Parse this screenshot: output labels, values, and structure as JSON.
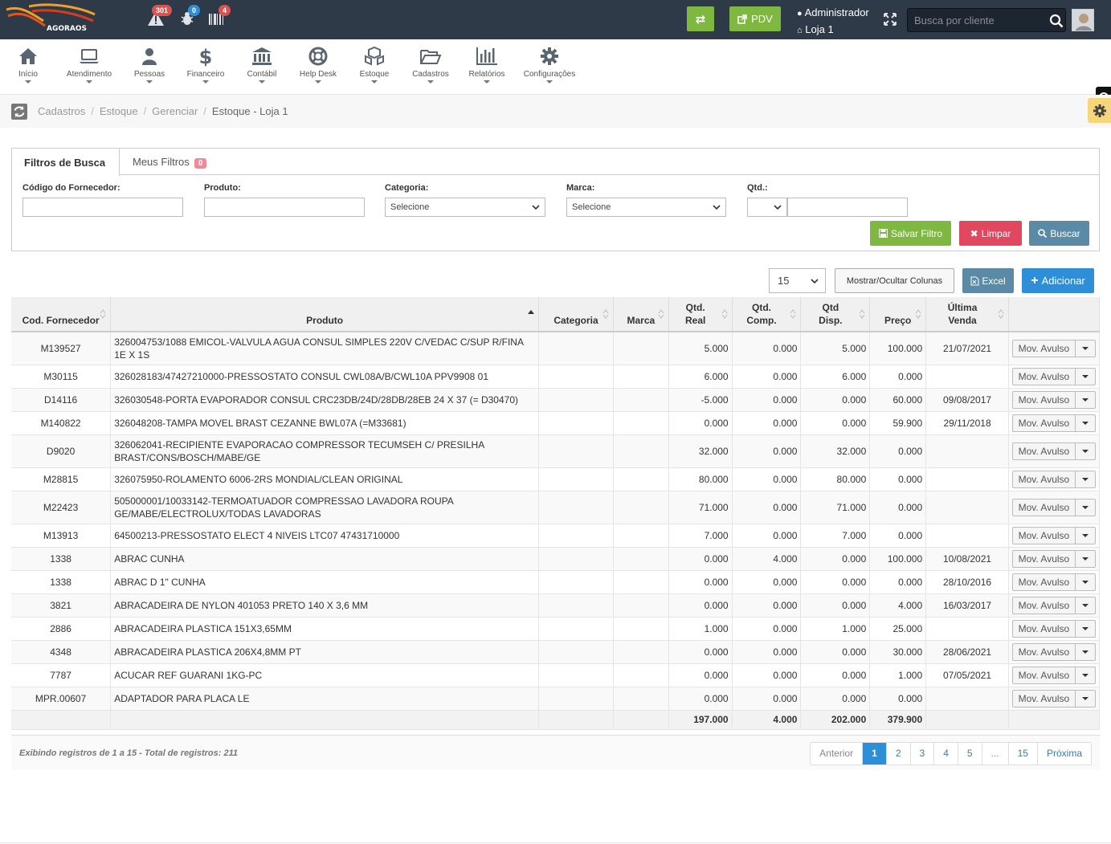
{
  "brand": {
    "logo_text": "AGORAOS"
  },
  "topbar": {
    "alerts": [
      {
        "icon": "warning-icon",
        "count": "301",
        "color": "#d9534f"
      },
      {
        "icon": "bug-icon",
        "count": "0",
        "color": "#2e8ed8"
      },
      {
        "icon": "barcode-icon",
        "count": "4",
        "color": "#d9534f"
      }
    ],
    "swap_label": "⇄",
    "pdv_label": "PDV",
    "user": "Administrador",
    "store": "Loja 1",
    "search_placeholder": "Busca por cliente"
  },
  "menu": [
    {
      "label": "Início",
      "icon": "home-icon"
    },
    {
      "label": "Atendimento",
      "icon": "laptop-icon"
    },
    {
      "label": "Pessoas",
      "icon": "user-icon"
    },
    {
      "label": "Financeiro",
      "icon": "dollar-icon"
    },
    {
      "label": "Contábil",
      "icon": "bank-icon"
    },
    {
      "label": "Help Desk",
      "icon": "lifebuoy-icon"
    },
    {
      "label": "Estoque",
      "icon": "cubes-icon"
    },
    {
      "label": "Cadastros",
      "icon": "folder-icon"
    },
    {
      "label": "Relatórios",
      "icon": "bar-chart-icon"
    },
    {
      "label": "Configurações",
      "icon": "gear-icon"
    }
  ],
  "breadcrumb": [
    "Cadastros",
    "Estoque",
    "Gerenciar",
    "Estoque - Loja 1"
  ],
  "filters": {
    "tab_active": "Filtros de Busca",
    "tab_other": "Meus Filtros",
    "tab_other_count": "0",
    "labels": {
      "supplier_code": "Código do Fornecedor:",
      "product": "Produto:",
      "category": "Categoria:",
      "brand": "Marca:",
      "qty": "Qtd.:"
    },
    "category_value": "Selecione",
    "brand_value": "Selecione",
    "save_label": "Salvar Filtro",
    "clear_label": "Limpar",
    "search_label": "Buscar"
  },
  "toolbar": {
    "page_size": "15",
    "columns_label": "Mostrar/Ocultar Colunas",
    "excel_label": "Excel",
    "add_label": "Adicionar"
  },
  "table": {
    "headers": [
      "Cod. Fornecedor",
      "Produto",
      "Categoria",
      "Marca",
      "Qtd. Real",
      "Qtd. Comp.",
      "Qtd Disp.",
      "Preço",
      "Última Venda"
    ],
    "action_label": "Mov. Avulso",
    "rows": [
      {
        "code": "M139527",
        "product": "326004753/1088 EMICOL-VALVULA AGUA CONSUL SIMPLES 220V C/VEDAC C/SUP R/FINA 1E X 1S",
        "category": "",
        "brand": "",
        "real": "5.000",
        "comp": "0.000",
        "disp": "5.000",
        "price": "100.000",
        "last": "21/07/2021"
      },
      {
        "code": "M30115",
        "product": "326028183/47427210000-PRESSOSTATO CONSUL CWL08A/B/CWL10A PPV9908 01",
        "category": "",
        "brand": "",
        "real": "6.000",
        "comp": "0.000",
        "disp": "6.000",
        "price": "0.000",
        "last": ""
      },
      {
        "code": "D14116",
        "product": "326030548-PORTA EVAPORADOR CONSUL CRC23DB/24D/28DB/28EB 24 X 37 (= D30470)",
        "category": "",
        "brand": "",
        "real": "-5.000",
        "comp": "0.000",
        "disp": "0.000",
        "price": "60.000",
        "last": "09/08/2017"
      },
      {
        "code": "M140822",
        "product": "326048208-TAMPA MOVEL BRAST CEZANNE BWL07A (=M33681)",
        "category": "",
        "brand": "",
        "real": "0.000",
        "comp": "0.000",
        "disp": "0.000",
        "price": "59.900",
        "last": "29/11/2018"
      },
      {
        "code": "D9020",
        "product": "326062041-RECIPIENTE EVAPORACAO COMPRESSOR TECUMSEH C/ PRESILHA BRAST/CONS/BOSCH/MABE/GE",
        "category": "",
        "brand": "",
        "real": "32.000",
        "comp": "0.000",
        "disp": "32.000",
        "price": "0.000",
        "last": ""
      },
      {
        "code": "M28815",
        "product": "326075950-ROLAMENTO 6006-2RS MONDIAL/CLEAN ORIGINAL",
        "category": "",
        "brand": "",
        "real": "80.000",
        "comp": "0.000",
        "disp": "80.000",
        "price": "0.000",
        "last": ""
      },
      {
        "code": "M22423",
        "product": "505000001/10033142-TERMOATUADOR COMPRESSAO LAVADORA ROUPA GE/MABE/ELECTROLUX/TODAS LAVADORAS",
        "category": "",
        "brand": "",
        "real": "71.000",
        "comp": "0.000",
        "disp": "71.000",
        "price": "0.000",
        "last": ""
      },
      {
        "code": "M13913",
        "product": "64500213-PRESSOSTATO ELECT 4 NIVEIS LTC07 47431710000",
        "category": "",
        "brand": "",
        "real": "7.000",
        "comp": "0.000",
        "disp": "7.000",
        "price": "0.000",
        "last": ""
      },
      {
        "code": "1338",
        "product": "ABRAC CUNHA",
        "category": "",
        "brand": "",
        "real": "0.000",
        "comp": "4.000",
        "disp": "0.000",
        "price": "100.000",
        "last": "10/08/2021"
      },
      {
        "code": "1338",
        "product": "ABRAC D 1\" CUNHA",
        "category": "",
        "brand": "",
        "real": "0.000",
        "comp": "0.000",
        "disp": "0.000",
        "price": "0.000",
        "last": "28/10/2016"
      },
      {
        "code": "3821",
        "product": "ABRACADEIRA DE NYLON 401053 PRETO 140 X 3,6 MM",
        "category": "",
        "brand": "",
        "real": "0.000",
        "comp": "0.000",
        "disp": "0.000",
        "price": "4.000",
        "last": "16/03/2017"
      },
      {
        "code": "2886",
        "product": "ABRACADEIRA PLASTICA 151X3,65MM",
        "category": "",
        "brand": "",
        "real": "1.000",
        "comp": "0.000",
        "disp": "1.000",
        "price": "25.000",
        "last": ""
      },
      {
        "code": "4348",
        "product": "ABRACADEIRA PLASTICA 206X4,8MM PT",
        "category": "",
        "brand": "",
        "real": "0.000",
        "comp": "0.000",
        "disp": "0.000",
        "price": "30.000",
        "last": "28/06/2021"
      },
      {
        "code": "7787",
        "product": "ACUCAR REF GUARANI 1KG-PC",
        "category": "",
        "brand": "",
        "real": "0.000",
        "comp": "0.000",
        "disp": "0.000",
        "price": "1.000",
        "last": "07/05/2021"
      },
      {
        "code": "MPR.00607",
        "product": "ADAPTADOR PARA PLACA LE",
        "category": "",
        "brand": "",
        "real": "0.000",
        "comp": "0.000",
        "disp": "0.000",
        "price": "0.000",
        "last": ""
      }
    ],
    "totals": {
      "real": "197.000",
      "comp": "4.000",
      "disp": "202.000",
      "price": "379.900"
    }
  },
  "footer": {
    "info": "Exibindo registros de 1 a 15 - Total de registros: 211",
    "pages": [
      "Anterior",
      "1",
      "2",
      "3",
      "4",
      "5",
      "...",
      "15",
      "Próxima"
    ]
  },
  "colors": {
    "topbar": "#2f3a48",
    "green": "#7eb840",
    "red": "#e0485f",
    "steel": "#5b8aa6",
    "blue": "#2e8ed8",
    "badge_red": "#d9534f"
  }
}
